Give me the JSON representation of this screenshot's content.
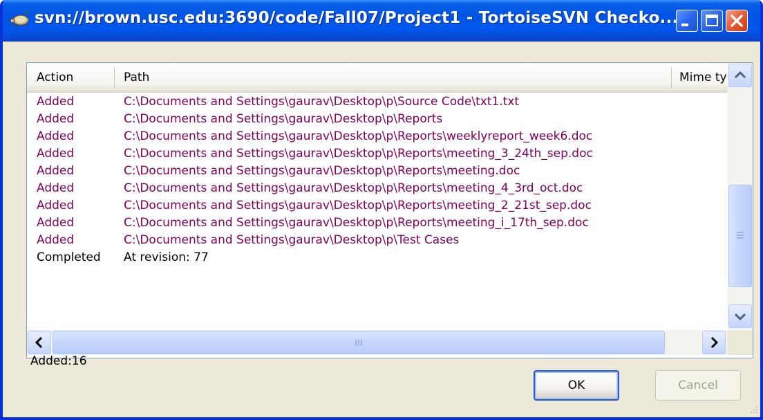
{
  "window": {
    "title": "svn://brown.usc.edu:3690/code/Fall07/Project1 - TortoiseSVN Checko...",
    "minimize_icon": "minimize-icon",
    "maximize_icon": "maximize-icon",
    "close_icon": "close-icon"
  },
  "list": {
    "columns": [
      "Action",
      "Path",
      "Mime ty"
    ],
    "rows": [
      {
        "action": "Added",
        "path": "C:\\Documents and Settings\\gaurav\\Desktop\\p\\Source Code\\txt1.txt"
      },
      {
        "action": "Added",
        "path": "C:\\Documents and Settings\\gaurav\\Desktop\\p\\Reports"
      },
      {
        "action": "Added",
        "path": "C:\\Documents and Settings\\gaurav\\Desktop\\p\\Reports\\weeklyreport_week6.doc"
      },
      {
        "action": "Added",
        "path": "C:\\Documents and Settings\\gaurav\\Desktop\\p\\Reports\\meeting_3_24th_sep.doc"
      },
      {
        "action": "Added",
        "path": "C:\\Documents and Settings\\gaurav\\Desktop\\p\\Reports\\meeting.doc"
      },
      {
        "action": "Added",
        "path": "C:\\Documents and Settings\\gaurav\\Desktop\\p\\Reports\\meeting_4_3rd_oct.doc"
      },
      {
        "action": "Added",
        "path": "C:\\Documents and Settings\\gaurav\\Desktop\\p\\Reports\\meeting_2_21st_sep.doc"
      },
      {
        "action": "Added",
        "path": "C:\\Documents and Settings\\gaurav\\Desktop\\p\\Reports\\meeting_i_17th_sep.doc"
      },
      {
        "action": "Added",
        "path": "C:\\Documents and Settings\\gaurav\\Desktop\\p\\Test Cases"
      },
      {
        "action": "Completed",
        "path": "At revision: 77"
      }
    ]
  },
  "summary": "Added:16",
  "buttons": {
    "ok": "OK",
    "cancel": "Cancel"
  },
  "colors": {
    "added": "#800060",
    "completed": "#000000",
    "title_bar": "#0054e3"
  }
}
